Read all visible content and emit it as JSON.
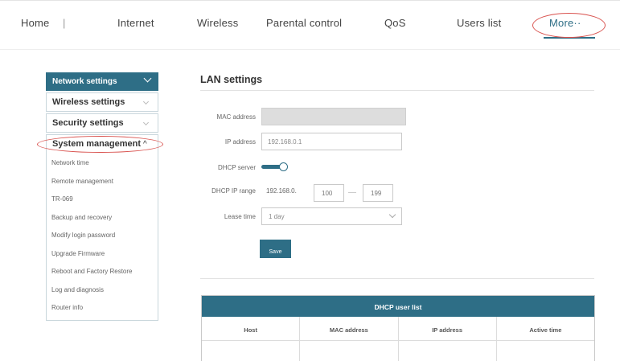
{
  "nav": {
    "home": "Home",
    "separator": "|",
    "internet": "Internet",
    "wireless": "Wireless",
    "parental": "Parental control",
    "qos": "QoS",
    "users": "Users list",
    "more": "More··"
  },
  "sidebar": {
    "network": "Network settings",
    "wireless": "Wireless settings",
    "security": "Security settings",
    "system": "System management",
    "system_icon": "^",
    "sub_items": [
      "Network time",
      "Remote management",
      "TR-069",
      "Backup and recovery",
      "Modify login password",
      "Upgrade Firmware",
      "Reboot and Factory Restore",
      "Log and diagnosis",
      "Router info"
    ]
  },
  "main": {
    "title": "LAN settings",
    "mac_label": "MAC address",
    "ip_label": "IP address",
    "ip_value": "192.168.0.1",
    "dhcp_label": "DHCP server",
    "range_label": "DHCP IP range",
    "range_prefix": "192.168.0.",
    "range_start": "100",
    "range_end": "199",
    "lease_label": "Lease time",
    "lease_value": "1 day",
    "save": "Save"
  },
  "table": {
    "title": "DHCP user list",
    "columns": [
      "Host",
      "MAC address",
      "IP address",
      "Active time"
    ]
  },
  "colors": {
    "accent": "#2e6e86",
    "highlight_circle": "#d9534f"
  }
}
